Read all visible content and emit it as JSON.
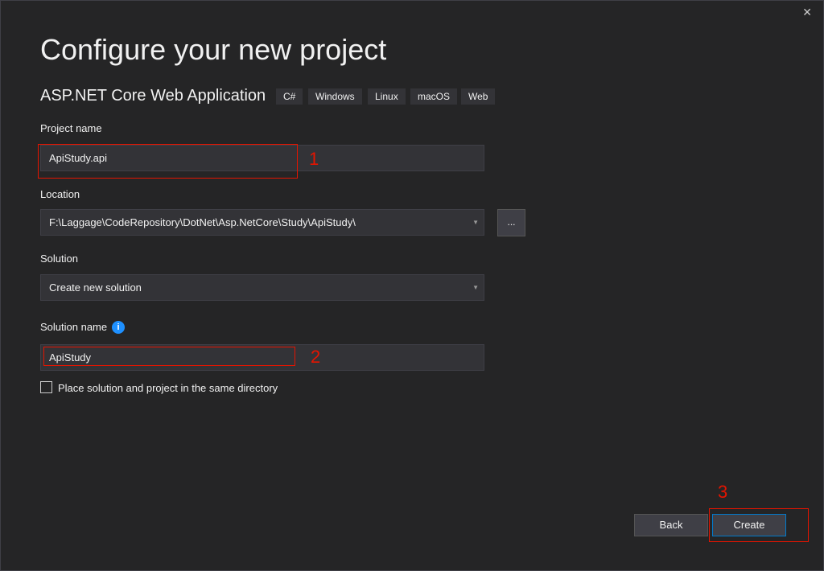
{
  "title": "Configure your new project",
  "template": "ASP.NET Core Web Application",
  "tags": [
    "C#",
    "Windows",
    "Linux",
    "macOS",
    "Web"
  ],
  "project_name": {
    "label": "Project name",
    "value": "ApiStudy.api"
  },
  "location": {
    "label": "Location",
    "value": "F:\\Laggage\\CodeRepository\\DotNet\\Asp.NetCore\\Study\\ApiStudy\\",
    "browse_label": "..."
  },
  "solution": {
    "label": "Solution",
    "value": "Create new solution"
  },
  "solution_name": {
    "label": "Solution name",
    "value": "ApiStudy",
    "info_icon": "i"
  },
  "same_dir": {
    "label": "Place solution and project in the same directory",
    "checked": false
  },
  "annotations": [
    "1",
    "2",
    "3"
  ],
  "buttons": {
    "back": "Back",
    "create": "Create",
    "close": "✕"
  },
  "colors": {
    "accent": "#007acc",
    "annotation": "#e51400",
    "info": "#1e90ff"
  }
}
